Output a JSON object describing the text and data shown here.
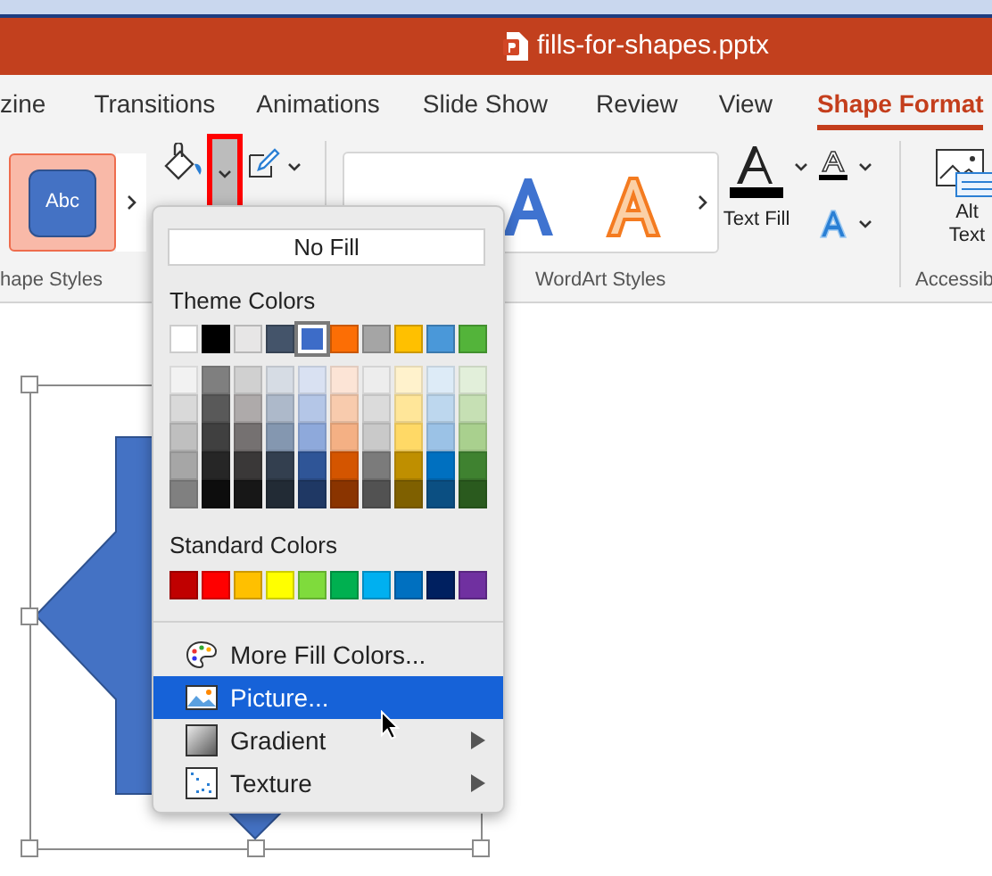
{
  "window": {
    "title": "fills-for-shapes.pptx"
  },
  "tabs": [
    {
      "label": "zine",
      "selected": false
    },
    {
      "label": "Transitions",
      "selected": false
    },
    {
      "label": "Animations",
      "selected": false
    },
    {
      "label": "Slide Show",
      "selected": false
    },
    {
      "label": "Review",
      "selected": false
    },
    {
      "label": "View",
      "selected": false
    },
    {
      "label": "Shape Format",
      "selected": true
    }
  ],
  "ribbon": {
    "shape_style": {
      "label": "Abc"
    },
    "fill_dropdown": {
      "highlighted": true
    },
    "text_fill": {
      "label": "Text Fill"
    },
    "alt_text": {
      "label": "Alt Text"
    },
    "groups": [
      "hape Styles",
      "WordArt Styles",
      "Accessib"
    ]
  },
  "fill_menu": {
    "no_fill": "No Fill",
    "theme_title": "Theme Colors",
    "theme_colors": [
      {
        "color": "#ffffff",
        "selected": false
      },
      {
        "color": "#000000",
        "selected": false
      },
      {
        "color": "#e7e6e6",
        "selected": false
      },
      {
        "color": "#44546a",
        "selected": false
      },
      {
        "color": "#3d6cc8",
        "selected": true
      },
      {
        "color": "#fc6e05",
        "selected": false
      },
      {
        "color": "#a5a5a5",
        "selected": false
      },
      {
        "color": "#ffc000",
        "selected": false
      },
      {
        "color": "#4a98d9",
        "selected": false
      },
      {
        "color": "#53b43a",
        "selected": false
      }
    ],
    "shade_rows": [
      {
        "swatches": [
          {
            "color": "#f2f2f2"
          },
          {
            "color": "#7f7f7f"
          },
          {
            "color": "#d0d0d0"
          },
          {
            "color": "#d6dce4"
          },
          {
            "color": "#d9e1f2"
          },
          {
            "color": "#fce4d6"
          },
          {
            "color": "#ededed"
          },
          {
            "color": "#fff2cc"
          },
          {
            "color": "#ddebf7"
          },
          {
            "color": "#e2efda"
          }
        ]
      },
      {
        "swatches": [
          {
            "color": "#d9d9d9"
          },
          {
            "color": "#595959"
          },
          {
            "color": "#aeaaaa"
          },
          {
            "color": "#adb9ca"
          },
          {
            "color": "#b4c6e7"
          },
          {
            "color": "#f8cbad"
          },
          {
            "color": "#dbdbdb"
          },
          {
            "color": "#ffe699"
          },
          {
            "color": "#bdd7ee"
          },
          {
            "color": "#c6e0b4"
          }
        ]
      },
      {
        "swatches": [
          {
            "color": "#bfbfbf"
          },
          {
            "color": "#404040"
          },
          {
            "color": "#757171"
          },
          {
            "color": "#8497b0"
          },
          {
            "color": "#8ea9db"
          },
          {
            "color": "#f4b084"
          },
          {
            "color": "#c9c9c9"
          },
          {
            "color": "#ffd966"
          },
          {
            "color": "#9bc2e6"
          },
          {
            "color": "#a9d08e"
          }
        ]
      },
      {
        "swatches": [
          {
            "color": "#a6a6a6"
          },
          {
            "color": "#262626"
          },
          {
            "color": "#3a3838"
          },
          {
            "color": "#333f4f"
          },
          {
            "color": "#2f5597"
          },
          {
            "color": "#d45500"
          },
          {
            "color": "#7b7b7b"
          },
          {
            "color": "#bf8f00"
          },
          {
            "color": "#0070c0"
          },
          {
            "color": "#3f8230"
          }
        ]
      },
      {
        "swatches": [
          {
            "color": "#808080"
          },
          {
            "color": "#0d0d0d"
          },
          {
            "color": "#171717"
          },
          {
            "color": "#222b35"
          },
          {
            "color": "#1f3864"
          },
          {
            "color": "#8a3400"
          },
          {
            "color": "#525252"
          },
          {
            "color": "#7f6000"
          },
          {
            "color": "#0b4f82"
          },
          {
            "color": "#2a5a1e"
          }
        ]
      }
    ],
    "standard_title": "Standard Colors",
    "standard_colors": [
      {
        "color": "#c00000"
      },
      {
        "color": "#ff0000"
      },
      {
        "color": "#ffc000"
      },
      {
        "color": "#ffff00"
      },
      {
        "color": "#7fdb3c"
      },
      {
        "color": "#00b050"
      },
      {
        "color": "#00b0f0"
      },
      {
        "color": "#0070c0"
      },
      {
        "color": "#002060"
      },
      {
        "color": "#7030a0"
      }
    ],
    "items": [
      {
        "kind": "palette",
        "label": "More Fill Colors...",
        "selected": false,
        "submenu": false
      },
      {
        "kind": "image",
        "label": "Picture...",
        "selected": true,
        "submenu": false
      },
      {
        "kind": "gradient",
        "label": "Gradient",
        "selected": false,
        "submenu": true
      },
      {
        "kind": "texture",
        "label": "Texture",
        "selected": false,
        "submenu": true
      }
    ]
  }
}
